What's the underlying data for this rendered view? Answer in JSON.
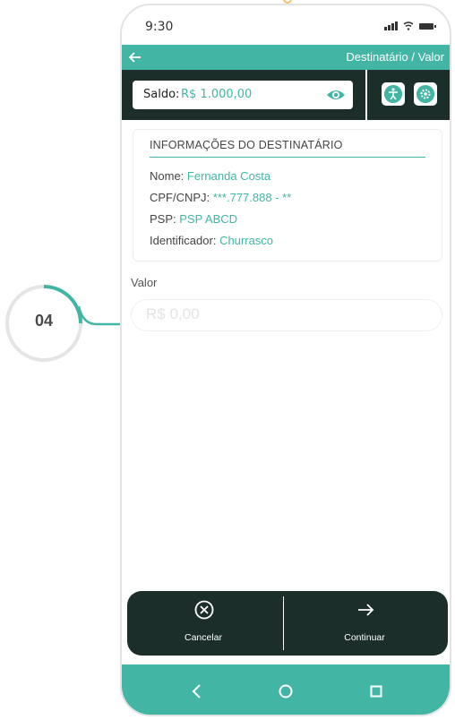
{
  "status": {
    "time": "9:30"
  },
  "header": {
    "title": "Destinatário / Valor"
  },
  "balance": {
    "label": "Saldo:",
    "value": "R$ 1.000,00"
  },
  "recipient_card": {
    "title": "INFORMAÇÕES DO DESTINATÁRIO",
    "rows": [
      {
        "label": "Nome:",
        "value": "Fernanda Costa"
      },
      {
        "label": "CPF/CNPJ:",
        "value": "***.777.888 - **"
      },
      {
        "label": "PSP:",
        "value": "PSP ABCD"
      },
      {
        "label": "Identificador:",
        "value": "Churrasco"
      }
    ]
  },
  "amount": {
    "label": "Valor",
    "placeholder": "R$ 0,00"
  },
  "actions": {
    "cancel": "Cancelar",
    "continue": "Continuar"
  },
  "step": {
    "number": "04"
  },
  "colors": {
    "accent": "#43b5a4",
    "dark": "#1c2e2a"
  },
  "icons": [
    "back-arrow-icon",
    "eye-icon",
    "accessibility-icon",
    "settings-icon",
    "cancel-circle-icon",
    "arrow-right-icon",
    "nav-back-icon",
    "nav-home-icon",
    "nav-recent-icon"
  ]
}
